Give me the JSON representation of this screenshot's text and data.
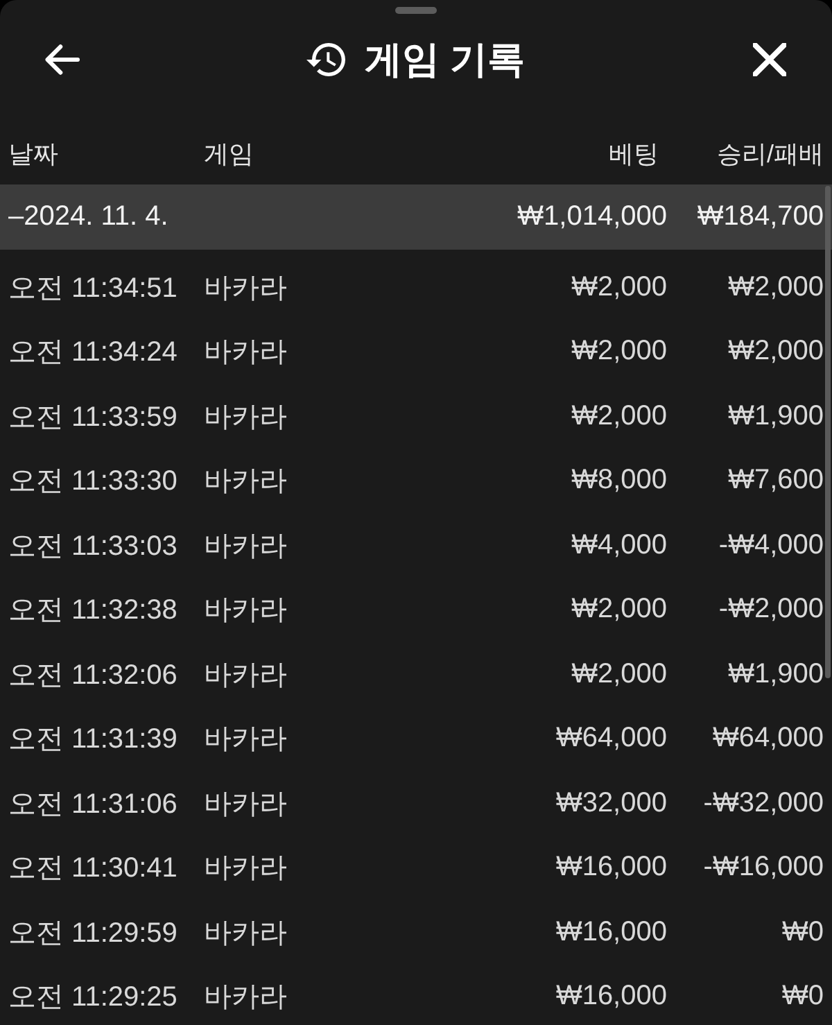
{
  "sheet": {
    "title": "게임 기록"
  },
  "table": {
    "columns": [
      "날짜",
      "게임",
      "베팅",
      "승리/패배"
    ],
    "groups": [
      {
        "date": "–2024. 11. 4.",
        "bet_total": "₩1,014,000",
        "result_total": "₩184,700",
        "rows": [
          {
            "time": "오전 11:34:51",
            "game": "바카라",
            "bet": "₩2,000",
            "result": "₩2,000"
          },
          {
            "time": "오전 11:34:24",
            "game": "바카라",
            "bet": "₩2,000",
            "result": "₩2,000"
          },
          {
            "time": "오전 11:33:59",
            "game": "바카라",
            "bet": "₩2,000",
            "result": "₩1,900"
          },
          {
            "time": "오전 11:33:30",
            "game": "바카라",
            "bet": "₩8,000",
            "result": "₩7,600"
          },
          {
            "time": "오전 11:33:03",
            "game": "바카라",
            "bet": "₩4,000",
            "result": "-₩4,000"
          },
          {
            "time": "오전 11:32:38",
            "game": "바카라",
            "bet": "₩2,000",
            "result": "-₩2,000"
          },
          {
            "time": "오전 11:32:06",
            "game": "바카라",
            "bet": "₩2,000",
            "result": "₩1,900"
          },
          {
            "time": "오전 11:31:39",
            "game": "바카라",
            "bet": "₩64,000",
            "result": "₩64,000"
          },
          {
            "time": "오전 11:31:06",
            "game": "바카라",
            "bet": "₩32,000",
            "result": "-₩32,000"
          },
          {
            "time": "오전 11:30:41",
            "game": "바카라",
            "bet": "₩16,000",
            "result": "-₩16,000"
          },
          {
            "time": "오전 11:29:59",
            "game": "바카라",
            "bet": "₩16,000",
            "result": "₩0"
          },
          {
            "time": "오전 11:29:25",
            "game": "바카라",
            "bet": "₩16,000",
            "result": "₩0"
          }
        ]
      }
    ]
  }
}
